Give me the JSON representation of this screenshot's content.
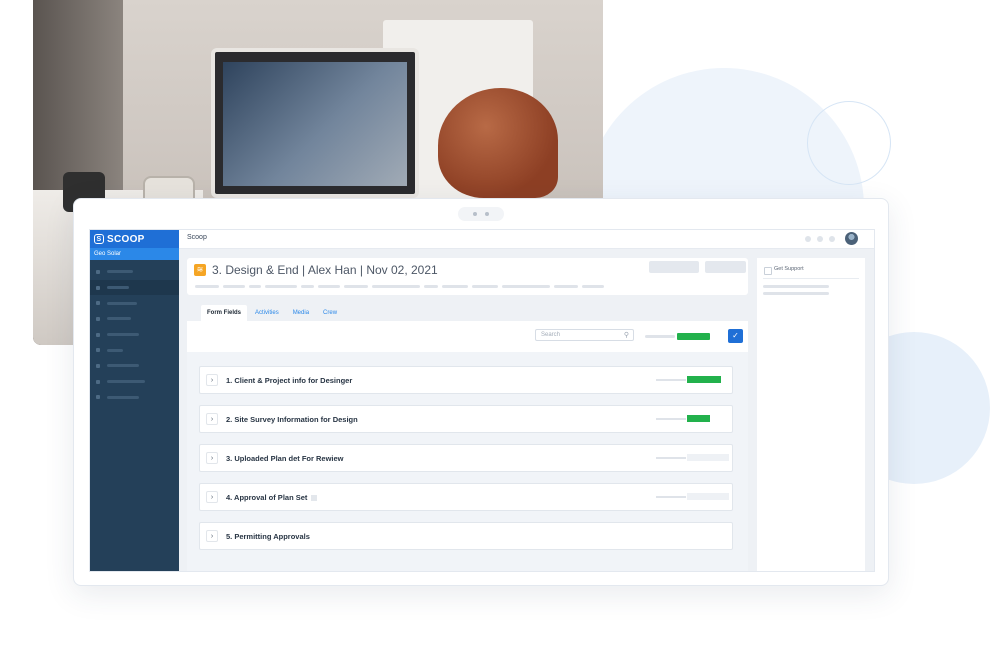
{
  "app": {
    "brand": "SCOOP",
    "organization": "Geo Solar",
    "breadcrumb": "Scoop"
  },
  "header": {
    "title": "3. Design & End | Alex Han | Nov 02, 2021"
  },
  "tabs": [
    {
      "label": "Form Fields",
      "active": true
    },
    {
      "label": "Activities",
      "active": false
    },
    {
      "label": "Media",
      "active": false
    },
    {
      "label": "Crew",
      "active": false
    }
  ],
  "search": {
    "placeholder": "Search"
  },
  "overall_progress": 1.0,
  "sections": [
    {
      "label": "1. Client & Project info for Desinger",
      "progress": 0.8
    },
    {
      "label": "2. Site Survey Information for Design",
      "progress": 0.55
    },
    {
      "label": "3. Uploaded Plan det For Rewiew",
      "progress": 0
    },
    {
      "label": "4. Approval of Plan Set",
      "progress": 0
    },
    {
      "label": "5. Permitting Approvals",
      "progress": null
    }
  ],
  "right_panel": {
    "support_label": "Get Support"
  },
  "colors": {
    "accent": "#1f6fd6",
    "sidebar": "#244059",
    "progress": "#22b14c",
    "header_icon": "#f5a524"
  },
  "icons": {
    "logo": "shield-logo-icon",
    "header": "layers-icon",
    "search": "search-icon",
    "save": "check-icon",
    "expand": "chevron-right-icon"
  }
}
